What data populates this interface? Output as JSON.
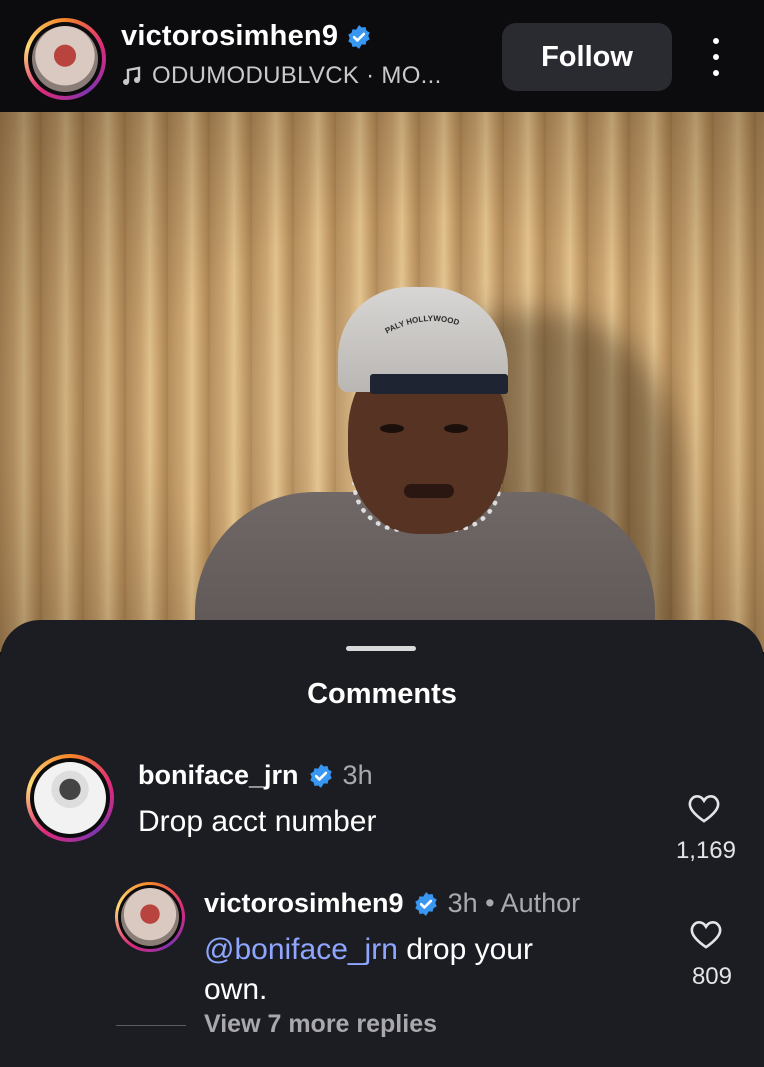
{
  "header": {
    "username": "victorosimhen9",
    "music": "ODUMODUBLVCK · MO...",
    "follow_label": "Follow"
  },
  "photo": {
    "cap_text": "PALY HOLLYWOOD"
  },
  "comments_panel": {
    "title": "Comments",
    "comments": [
      {
        "username": "boniface_jrn",
        "time": "3h",
        "text": "Drop acct number",
        "likes": "1,169"
      }
    ],
    "reply": {
      "username": "victorosimhen9",
      "meta": "3h • Author",
      "mention": "@boniface_jrn",
      "text_rest": " drop your own.",
      "likes": "809"
    },
    "view_more": "View 7 more replies"
  },
  "colors": {
    "verified": "#3897f0",
    "mention": "#8ea6ff",
    "sheet_bg": "#1c1d22"
  }
}
